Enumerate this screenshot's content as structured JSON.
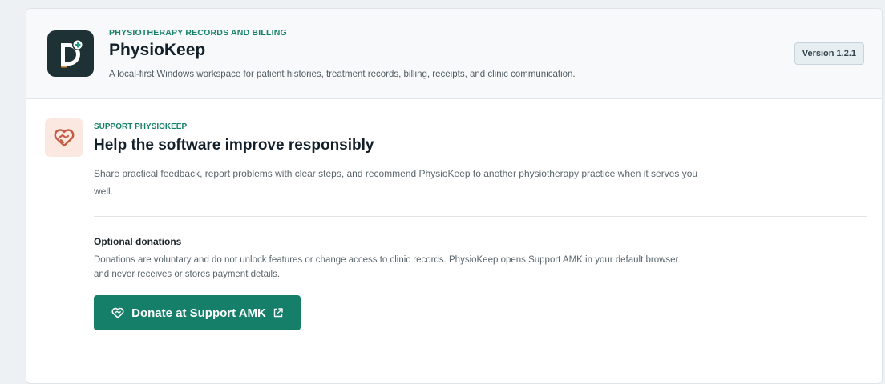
{
  "header": {
    "eyebrow": "PHYSIOTHERAPY RECORDS AND BILLING",
    "app_name": "PhysioKeep",
    "description": "A local-first Windows workspace for patient histories, treatment records, billing, receipts, and clinic communication.",
    "version": "Version 1.2.1",
    "logo_icon": "physiokeep-logo-icon"
  },
  "support": {
    "icon": "heart-handshake-icon",
    "eyebrow": "SUPPORT PHYSIOKEEP",
    "title": "Help the software improve responsibly",
    "description": "Share practical feedback, report problems with clear steps, and recommend PhysioKeep to another physiotherapy practice when it serves you well."
  },
  "donations": {
    "title": "Optional donations",
    "description": "Donations are voluntary and do not unlock features or change access to clinic records. PhysioKeep opens Support AMK in your default browser and never receives or stores payment details.",
    "button_label": "Donate at Support AMK",
    "button_icon": "heart-hand-icon",
    "external_icon": "external-link-icon"
  },
  "colors": {
    "accent": "#167f6a",
    "logo_bg": "#1e3134",
    "support_icon_bg": "#fbe8e1",
    "support_icon_fg": "#c65a43"
  }
}
